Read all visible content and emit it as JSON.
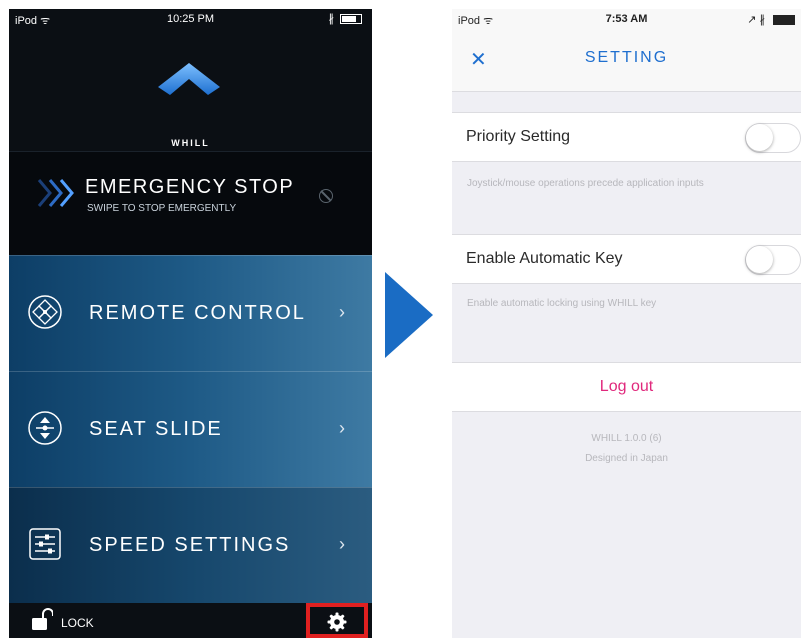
{
  "left_screen": {
    "status_bar": {
      "carrier": "iPod ᯤ",
      "time": "10:25 PM",
      "bluetooth": "∦"
    },
    "logo": {
      "brand": "WHILL"
    },
    "emergency": {
      "title": "EMERGENCY STOP",
      "subtitle": "SWIPE TO STOP EMERGENTLY"
    },
    "menu": [
      {
        "label": "REMOTE CONTROL",
        "chevron": "›",
        "icon": "dpad-icon"
      },
      {
        "label": "SEAT SLIDE",
        "chevron": "›",
        "icon": "seat-slide-icon"
      },
      {
        "label": "SPEED SETTINGS",
        "chevron": "›",
        "icon": "sliders-icon"
      }
    ],
    "bottom": {
      "lock_label": "LOCK",
      "settings_icon": "gear-icon",
      "highlight_color": "#e02020"
    }
  },
  "right_screen": {
    "status_bar": {
      "carrier": "iPod ᯤ",
      "time": "7:53 AM",
      "indicators": "↗ ∦"
    },
    "header": {
      "close": "✕",
      "title": "SETTING"
    },
    "rows": [
      {
        "label": "Priority Setting",
        "toggle_on": false,
        "note": "Joystick/mouse operations precede application inputs"
      },
      {
        "label": "Enable Automatic Key",
        "toggle_on": false,
        "note": "Enable automatic locking using WHILL key"
      }
    ],
    "logout": {
      "label": "Log out",
      "color": "#e0287c"
    },
    "footer": {
      "version": "WHILL 1.0.0 (6)",
      "tagline": "Designed in Japan"
    }
  },
  "colors": {
    "accent_blue": "#1f6fcf",
    "arrow_blue": "#1a6cc4"
  }
}
